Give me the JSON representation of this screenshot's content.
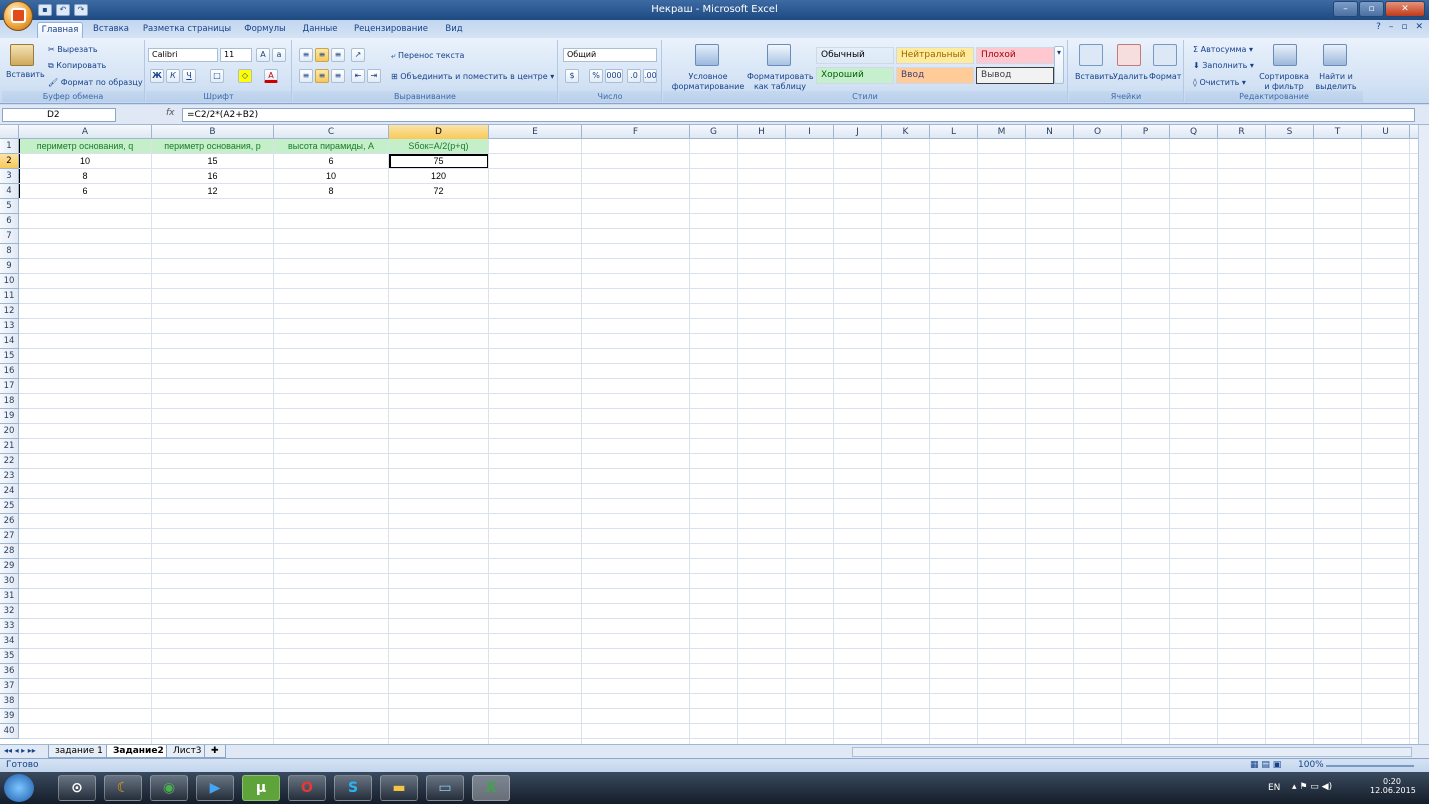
{
  "window": {
    "title": "Некраш - Microsoft Excel"
  },
  "tabs": [
    "Главная",
    "Вставка",
    "Разметка страницы",
    "Формулы",
    "Данные",
    "Рецензирование",
    "Вид"
  ],
  "ribbon": {
    "clipboard": {
      "paste": "Вставить",
      "cut": "Вырезать",
      "copy": "Копировать",
      "format_painter": "Формат по образцу",
      "label": "Буфер обмена"
    },
    "font": {
      "name": "Calibri",
      "size": "11",
      "bold": "Ж",
      "italic": "К",
      "underline": "Ч",
      "label": "Шрифт"
    },
    "alignment": {
      "wrap": "Перенос текста",
      "merge": "Объединить и поместить в центре",
      "label": "Выравнивание"
    },
    "number": {
      "format": "Общий",
      "percent": "%",
      "thousands": "000",
      "label": "Число"
    },
    "styles": {
      "conditional": "Условное форматирование",
      "as_table": "Форматировать как таблицу",
      "cells": [
        {
          "name": "Обычный",
          "bg": "#ffffff",
          "fg": "#000000"
        },
        {
          "name": "Нейтральный",
          "bg": "#ffeb9c",
          "fg": "#9c6500"
        },
        {
          "name": "Плохой",
          "bg": "#ffc7ce",
          "fg": "#9c0006"
        },
        {
          "name": "Хороший",
          "bg": "#c6efce",
          "fg": "#006100"
        },
        {
          "name": "Ввод",
          "bg": "#ffcc99",
          "fg": "#3f3f76"
        },
        {
          "name": "Вывод",
          "bg": "#f2f2f2",
          "fg": "#3f3f3f"
        }
      ],
      "label": "Стили"
    },
    "cells": {
      "insert": "Вставить",
      "delete": "Удалить",
      "format": "Формат",
      "label": "Ячейки"
    },
    "editing": {
      "autosum": "Автосумма",
      "fill": "Заполнить",
      "clear": "Очистить",
      "sort": "Сортировка и фильтр",
      "find": "Найти и выделить",
      "label": "Редактирование"
    }
  },
  "formula_bar": {
    "name_box": "D2",
    "fx": "fx",
    "formula": "=C2/2*(A2+B2)"
  },
  "columns": [
    "A",
    "B",
    "C",
    "D",
    "E",
    "F",
    "G",
    "H",
    "I",
    "J",
    "K",
    "L",
    "M",
    "N",
    "O",
    "P",
    "Q",
    "R",
    "S",
    "T",
    "U"
  ],
  "rows_count": 40,
  "table": {
    "headers": [
      "периметр основания, q",
      "периметр основания, p",
      "высота пирамиды, A",
      "Sбок=A/2(p+q)"
    ],
    "rows": [
      [
        "10",
        "15",
        "6",
        "75"
      ],
      [
        "8",
        "16",
        "10",
        "120"
      ],
      [
        "6",
        "12",
        "8",
        "72"
      ]
    ]
  },
  "sheets": [
    {
      "name": "задание 1",
      "active": false
    },
    {
      "name": "Задание2",
      "active": true
    },
    {
      "name": "Лист3",
      "active": false
    }
  ],
  "status": {
    "ready": "Готово",
    "zoom": "100%"
  },
  "taskbar": {
    "lang": "EN",
    "time": "0:20",
    "date": "12.06.2015"
  }
}
